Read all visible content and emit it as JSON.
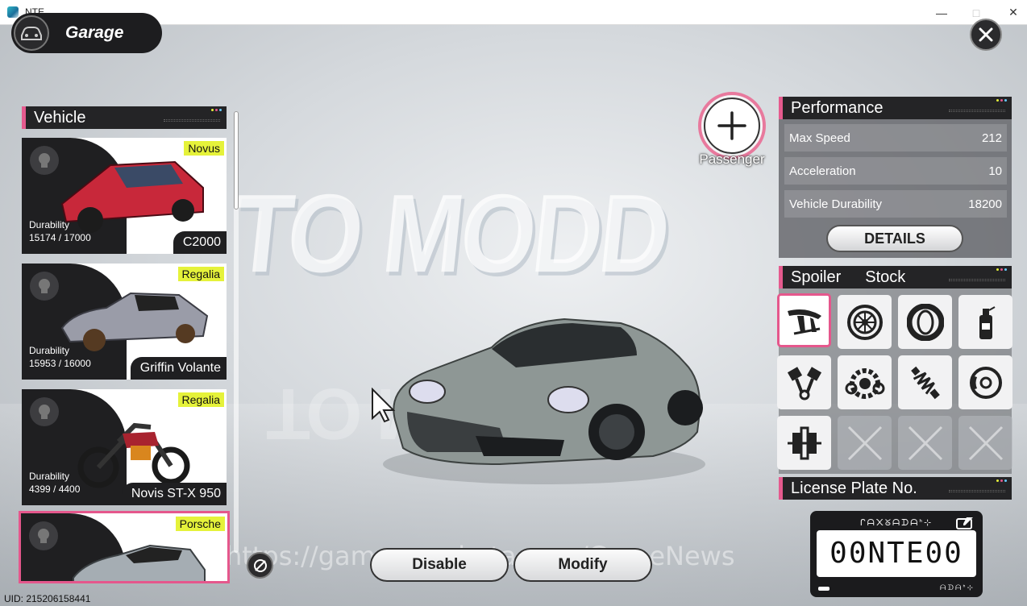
{
  "window": {
    "title": "NTE"
  },
  "header": {
    "garage_label": "Garage"
  },
  "vehicle_list": {
    "title": "Vehicle",
    "items": [
      {
        "brand": "Novus",
        "durability_label": "Durability",
        "durability": "15174 / 17000",
        "name": "C2000"
      },
      {
        "brand": "Regalia",
        "durability_label": "Durability",
        "durability": "15953 / 16000",
        "name": "Griffin Volante"
      },
      {
        "brand": "Regalia",
        "durability_label": "Durability",
        "durability": "4399 / 4400",
        "name": "Novis ST-X 950"
      },
      {
        "brand": "Porsche"
      }
    ]
  },
  "passenger": {
    "label": "Passenger"
  },
  "performance": {
    "title": "Performance",
    "rows": [
      {
        "label": "Max Speed",
        "value": "212"
      },
      {
        "label": "Acceleration",
        "value": "10"
      },
      {
        "label": "Vehicle Durability",
        "value": "18200"
      }
    ],
    "details_label": "DETAILS"
  },
  "parts": {
    "category": "Spoiler",
    "state": "Stock",
    "tiles": [
      {
        "icon": "spoiler-icon",
        "selected": true
      },
      {
        "icon": "wheel-rim-icon"
      },
      {
        "icon": "tire-icon"
      },
      {
        "icon": "spray-paint-icon"
      },
      {
        "icon": "piston-icon"
      },
      {
        "icon": "transmission-icon"
      },
      {
        "icon": "suspension-icon"
      },
      {
        "icon": "brake-icon"
      },
      {
        "icon": "clutch-icon"
      },
      {
        "icon": "empty-slot-icon"
      },
      {
        "icon": "empty-slot-icon"
      },
      {
        "icon": "empty-slot-icon"
      }
    ]
  },
  "license_plate": {
    "title": "License Plate No.",
    "number": "00NTE00",
    "script_top": "ᒋᗩ᙭ᘜᗩᗪᗩᑋ⊹",
    "script_bottom": "ᗩᗪᗩᑋ⊹"
  },
  "actions": {
    "disable_label": "Disable",
    "modify_label": "Modify"
  },
  "backdrop": {
    "sign_text": "TO MODD",
    "watermark": "https://gamenewsbeta.com/GameNews"
  },
  "footer": {
    "uid": "UID: 215206158441"
  },
  "colors": {
    "accent": "#e5578c",
    "brand_tag": "#e5f23a",
    "panel_dark": "#1f1f21"
  }
}
